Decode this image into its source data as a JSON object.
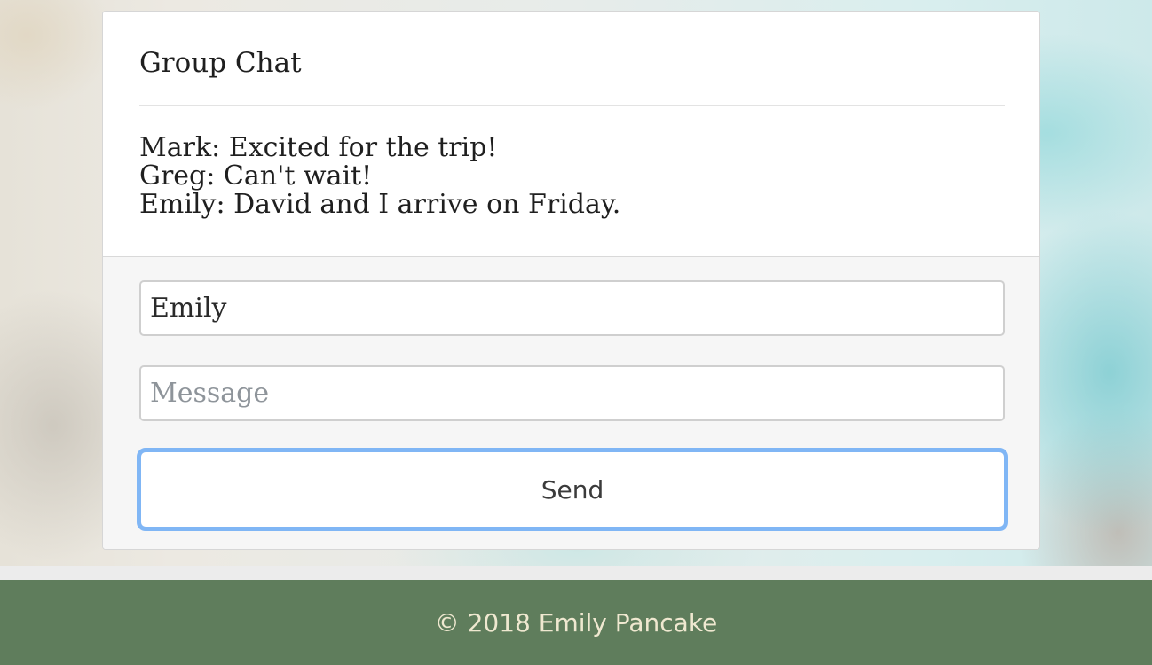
{
  "chat": {
    "title": "Group Chat",
    "messages": [
      {
        "text": "Mark: Excited for the trip!"
      },
      {
        "text": "Greg: Can't wait!"
      },
      {
        "text": "Emily: David and I arrive on Friday."
      }
    ]
  },
  "form": {
    "name_value": "Emily",
    "message_value": "",
    "message_placeholder": "Message",
    "send_label": "Send"
  },
  "footer": {
    "text": "© 2018 Emily Pancake"
  },
  "colors": {
    "footer_background": "#5f7d5c",
    "footer_text": "#efe8d0",
    "focus_ring": "#80b6f5"
  }
}
